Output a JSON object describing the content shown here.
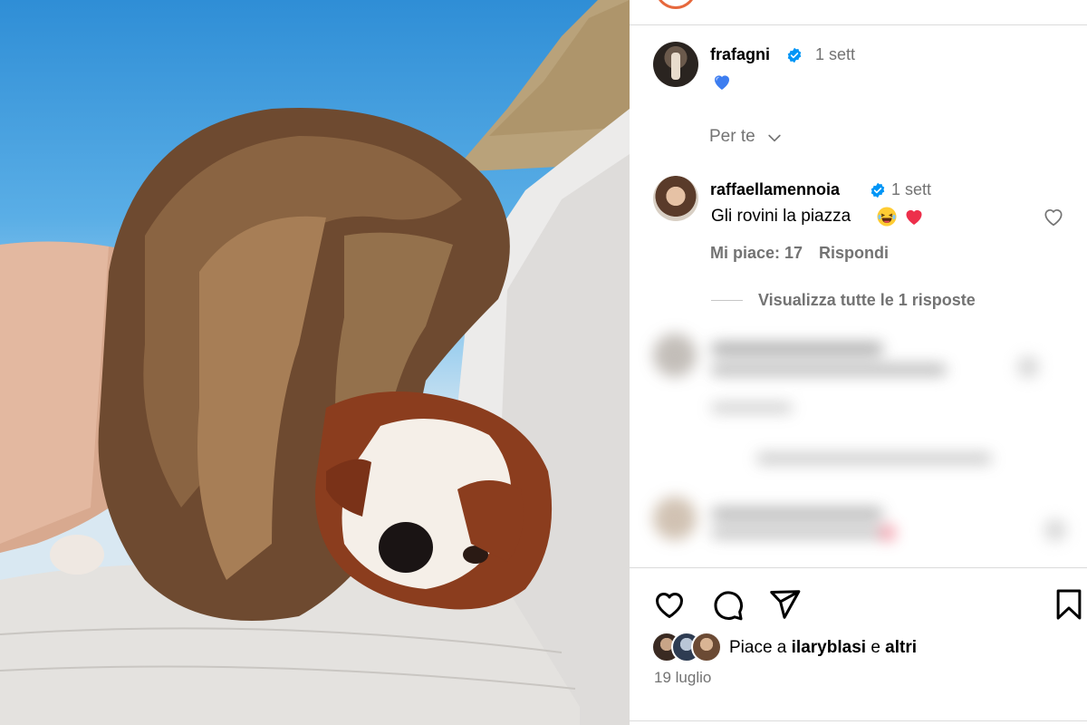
{
  "post": {
    "author": {
      "username": "frafagni",
      "verified": true,
      "time": "1 sett",
      "avatar_icon": "profile-photo"
    },
    "caption_emoji": "blue-heart-icon",
    "filter_label": "Per te"
  },
  "comments": [
    {
      "username": "raffaellamennoia",
      "verified": true,
      "time": "1 sett",
      "text": "Gli rovini la piazza",
      "emojis": [
        "laughing-emoji",
        "red-heart-emoji"
      ],
      "likes_label": "Mi piace: 17",
      "reply_label": "Rispondi",
      "view_replies": "Visualizza tutte le 1 risposte"
    }
  ],
  "actions": {
    "like_icon": "heart-icon",
    "comment_icon": "comment-icon",
    "share_icon": "send-icon",
    "save_icon": "bookmark-icon"
  },
  "likes": {
    "prefix": "Piace a ",
    "user": "ilaryblasi",
    "middle": " e ",
    "others": "altri"
  },
  "date": "19 luglio",
  "colors": {
    "verified": "#0095f6",
    "secondary_text": "#737373",
    "heart_red": "#ed4956"
  }
}
